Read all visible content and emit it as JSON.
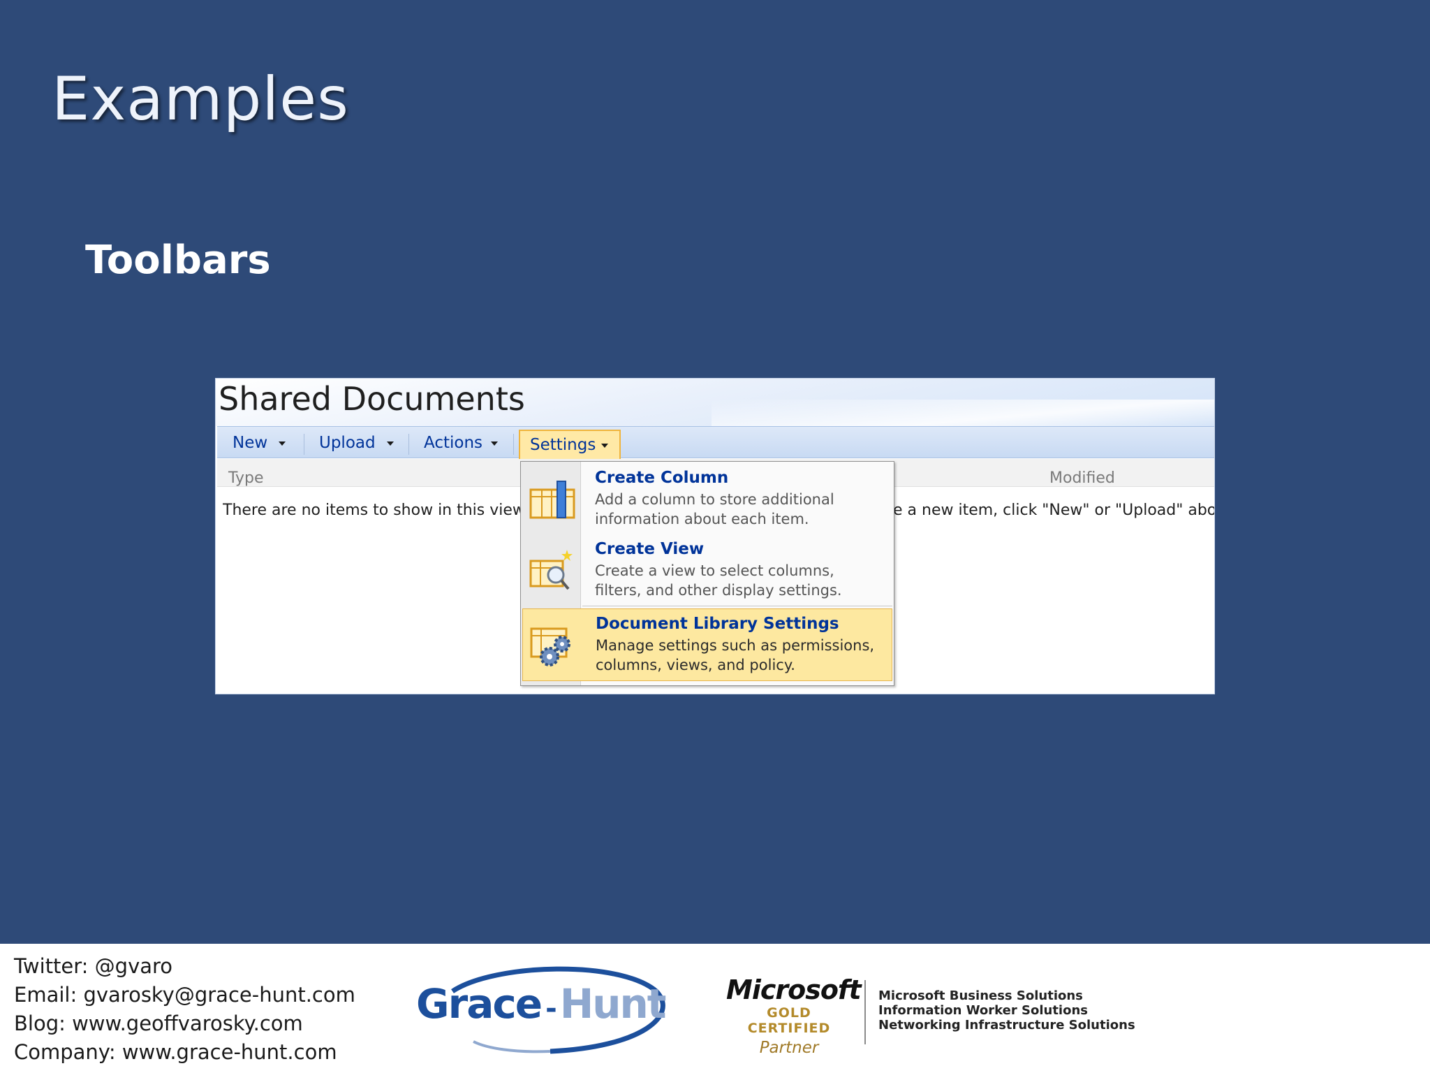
{
  "slide": {
    "title": "Examples",
    "subtitle": "Toolbars"
  },
  "library": {
    "title": "Shared Documents",
    "toolbar": {
      "new_label": "New",
      "upload_label": "Upload",
      "actions_label": "Actions",
      "settings_label": "Settings"
    },
    "columns": {
      "type": "Type",
      "modified": "Modified"
    },
    "empty_left": "There are no items to show in this view of",
    "empty_right": "e a new item, click \"New\" or \"Upload\" above."
  },
  "settings_menu": {
    "items": [
      {
        "title": "Create Column",
        "desc_line1": "Add a column to store additional",
        "desc_line2": "information about each item.",
        "icon": "create-column-icon"
      },
      {
        "title": "Create View",
        "desc_line1": "Create a view to select columns,",
        "desc_line2": "filters, and other display settings.",
        "icon": "create-view-icon"
      },
      {
        "title": "Document Library Settings",
        "desc_line1": "Manage settings such as permissions,",
        "desc_line2": "columns, views, and policy.",
        "icon": "library-settings-icon"
      }
    ]
  },
  "footer": {
    "twitter": "Twitter: @gvaro",
    "email": "Email: gvarosky@grace-hunt.com",
    "blog": "Blog: www.geoffvarosky.com",
    "company": "Company: www.grace-hunt.com",
    "logo_grace": "Grace",
    "logo_dash": "-",
    "logo_hunt": "Hunt",
    "ms_name": "Microsoft",
    "ms_gold": "GOLD CERTIFIED",
    "ms_partner": "Partner",
    "ms_solutions": [
      "Microsoft Business Solutions",
      "Information Worker Solutions",
      "Networking Infrastructure Solutions"
    ]
  },
  "colors": {
    "background": "#2e4a78",
    "link_blue": "#003399",
    "highlight": "#fde8a0"
  }
}
